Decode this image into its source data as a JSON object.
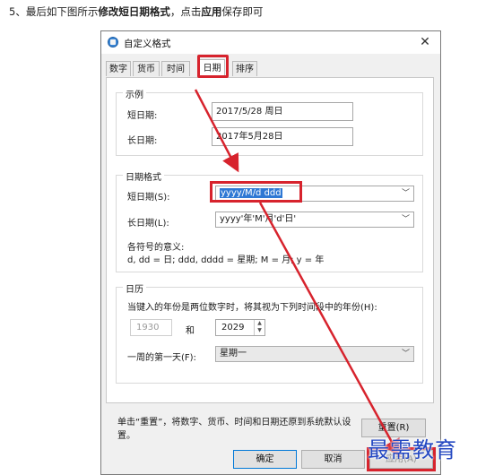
{
  "instruction": {
    "prefix": "5、最后如下图所示",
    "bold1": "修改短日期格式",
    "middle": "，点击",
    "bold2": "应用",
    "suffix": "保存即可"
  },
  "dialog": {
    "title": "自定义格式",
    "close": "✕"
  },
  "tabs": [
    {
      "label": "数字"
    },
    {
      "label": "货币"
    },
    {
      "label": "时间"
    },
    {
      "label": "日期"
    },
    {
      "label": "排序"
    }
  ],
  "example": {
    "legend": "示例",
    "short_label": "短日期:",
    "short_value": "2017/5/28 周日",
    "long_label": "长日期:",
    "long_value": "2017年5月28日"
  },
  "date_format": {
    "legend": "日期格式",
    "short_label": "短日期(S):",
    "short_value": "yyyy/M/d ddd",
    "long_label": "长日期(L):",
    "long_value": "yyyy'年'M'月'd'日'",
    "meaning_label": "各符号的意义:",
    "meaning_text": "d, dd = 日;  ddd, dddd = 星期;  M = 月;  y = 年"
  },
  "calendar": {
    "legend": "日历",
    "desc": "当键入的年份是两位数字时，将其视为下列时间段中的年份(H):",
    "from_year": "1930",
    "and": "和",
    "to_year": "2029",
    "first_day_label": "一周的第一天(F):",
    "first_day_value": "星期一"
  },
  "reset_note": "单击“重置”，将数字、货币、时间和日期还原到系统默认设置。",
  "buttons": {
    "reset": "重置(R)",
    "ok": "确定",
    "cancel": "取消",
    "apply": "应用(A)"
  },
  "watermark": "最需教育",
  "colors": {
    "highlight": "#d7232d",
    "selection": "#2f78d4",
    "watermark": "#2448c2"
  }
}
